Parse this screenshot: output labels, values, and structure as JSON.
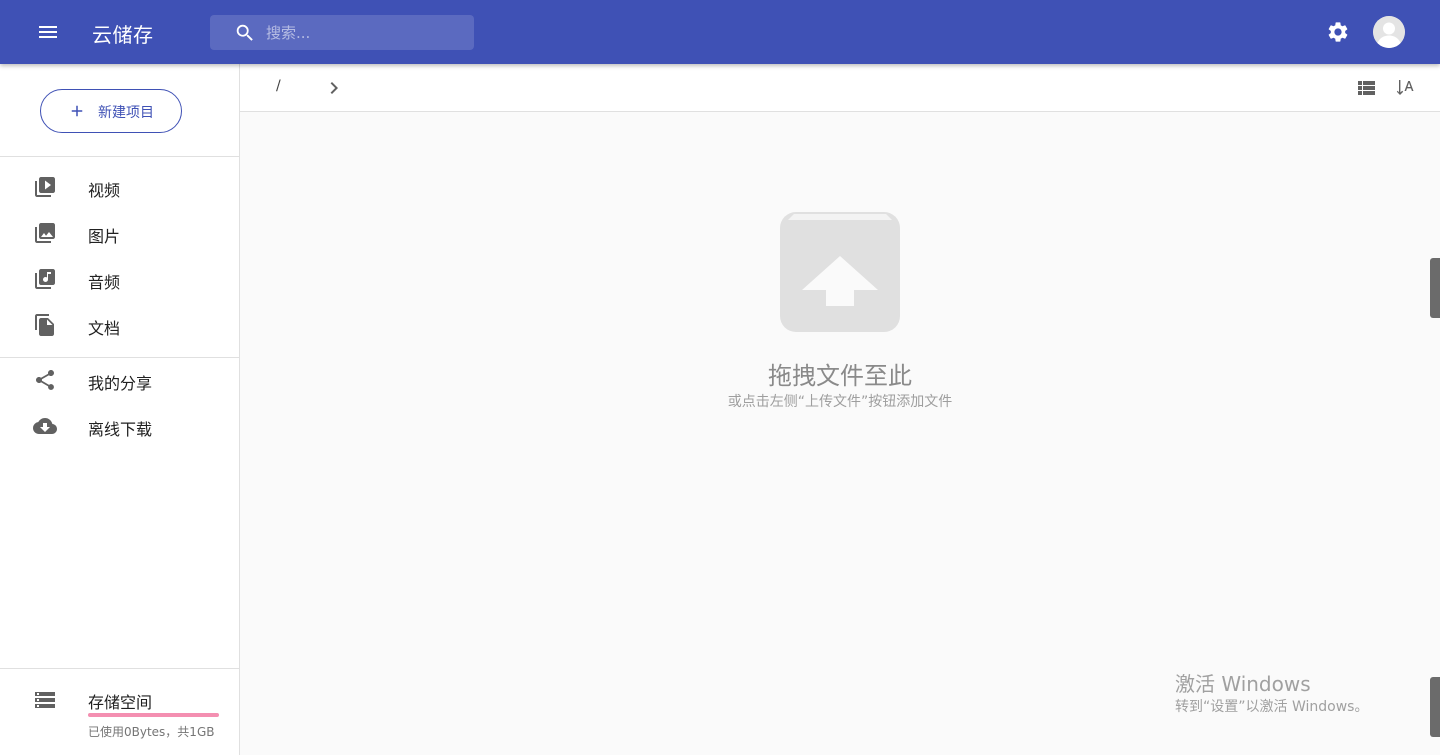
{
  "app": {
    "title": "云储存"
  },
  "search": {
    "placeholder": "搜索..."
  },
  "sidebar": {
    "new_button_label": "新建项目",
    "items": [
      {
        "label": "视频",
        "icon": "video-library-icon"
      },
      {
        "label": "图片",
        "icon": "photo-library-icon"
      },
      {
        "label": "音频",
        "icon": "library-music-icon"
      },
      {
        "label": "文档",
        "icon": "file-copy-icon"
      },
      {
        "label": "我的分享",
        "icon": "share-icon"
      },
      {
        "label": "离线下载",
        "icon": "cloud-download-icon"
      }
    ],
    "storage": {
      "title": "存储空间",
      "usage": "已使用0Bytes，共1GB",
      "used_fraction": 0
    }
  },
  "toolbar": {
    "breadcrumb_root": "/"
  },
  "empty_state": {
    "title": "拖拽文件至此",
    "subtitle": "或点击左侧“上传文件”按钮添加文件"
  },
  "watermark": {
    "title": "激活 Windows",
    "subtitle": "转到“设置”以激活 Windows。"
  },
  "colors": {
    "primary": "#3f51b5",
    "accent": "#e91e63",
    "accent_light": "#f48fb1"
  }
}
